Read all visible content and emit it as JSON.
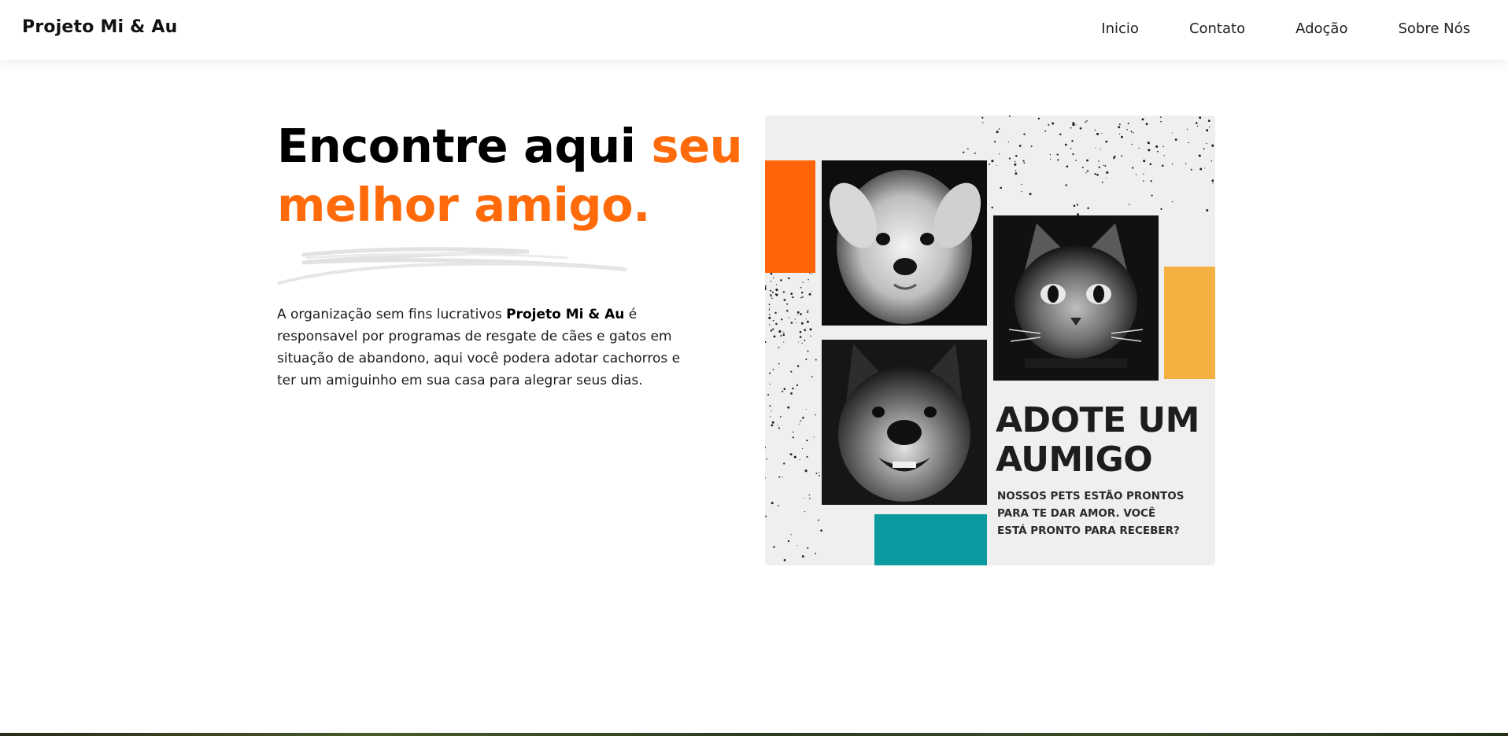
{
  "navbar": {
    "brand": "Projeto Mi & Au",
    "links": [
      "Inicio",
      "Contato",
      "Adoção",
      "Sobre Nós"
    ]
  },
  "hero": {
    "title_part1": "Encontre aqui ",
    "title_accent": "seu melhor amigo.",
    "intro_before": "A organização sem fins lucrativos ",
    "intro_bold": "Projeto Mi & Au",
    "intro_after": " é responsavel por programas de resgate de cães e gatos em situação de abandono, aqui você podera adotar cachorros e ter um amiguinho em sua casa para alegrar seus dias."
  },
  "poster": {
    "title": "ADOTE UM AUMIGO",
    "subtitle": "NOSSOS PETS ESTÃO PRONTOS PARA TE DAR AMOR. VOCÊ ESTÁ PRONTO PARA RECEBER?",
    "photos": [
      "dog-white-terrier",
      "cat-tabby",
      "dog-shepherd"
    ]
  },
  "colors": {
    "accent": "#ff6b0a",
    "poster_orange": "#ff6508",
    "poster_yellow": "#f4b142",
    "poster_teal": "#0a9aa0",
    "poster_background": "#efefef"
  }
}
